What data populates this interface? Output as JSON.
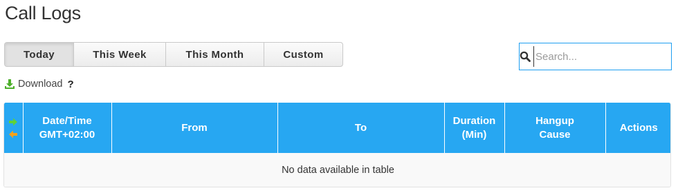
{
  "page": {
    "title": "Call Logs"
  },
  "filters": {
    "items": [
      {
        "label": "Today",
        "active": true
      },
      {
        "label": "This Week",
        "active": false
      },
      {
        "label": "This Month",
        "active": false
      },
      {
        "label": "Custom",
        "active": false
      }
    ]
  },
  "search": {
    "placeholder": "Search...",
    "value": ""
  },
  "download": {
    "label": "Download",
    "help": "?"
  },
  "table": {
    "columns": [
      {
        "key": "direction",
        "label": ""
      },
      {
        "key": "datetime",
        "label": "Date/Time",
        "sublabel": "GMT+02:00"
      },
      {
        "key": "from",
        "label": "From"
      },
      {
        "key": "to",
        "label": "To"
      },
      {
        "key": "duration",
        "label": "Duration",
        "sublabel": "(Min)"
      },
      {
        "key": "hangup",
        "label": "Hangup",
        "sublabel": "Cause"
      },
      {
        "key": "actions",
        "label": "Actions"
      }
    ],
    "rows": [],
    "empty_message": "No data available in table"
  },
  "colors": {
    "header_bg": "#27a7f2",
    "search_border": "#1e9ef0",
    "arrow_in": "#5fd13a",
    "arrow_out": "#f7a21b",
    "download_icon": "#4caf2a"
  }
}
